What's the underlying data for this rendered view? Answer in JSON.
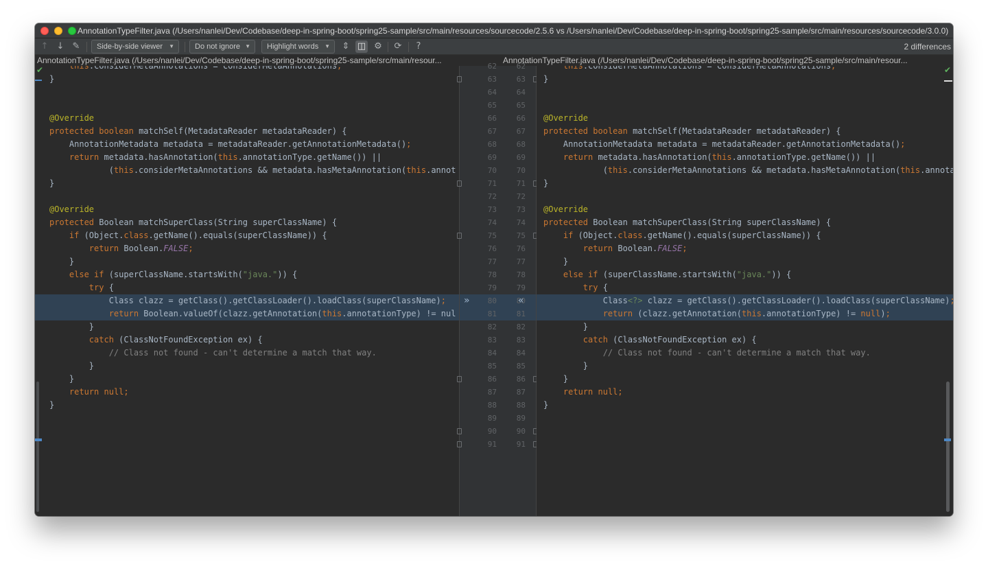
{
  "window": {
    "title": "AnnotationTypeFilter.java (/Users/nanlei/Dev/Codebase/deep-in-spring-boot/spring25-sample/src/main/resources/sourcecode/2.5.6 vs /Users/nanlei/Dev/Codebase/deep-in-spring-boot/spring25-sample/src/main/resources/sourcecode/3.0.0)"
  },
  "toolbar": {
    "prev_icon": "↑",
    "next_icon": "↓",
    "edit_icon": "✎",
    "viewer_label": "Side-by-side viewer",
    "ignore_label": "Do not ignore",
    "highlight_label": "Highlight words",
    "collapse_icon": "⇕",
    "sync_icon": "◫",
    "settings_icon": "⚙",
    "mark_icon": "⟳",
    "help_icon": "?",
    "differences": "2 differences"
  },
  "left_pane": {
    "header": "AnnotationTypeFilter.java (/Users/nanlei/Dev/Codebase/deep-in-spring-boot/spring25-sample/src/main/resour..."
  },
  "right_pane": {
    "header": "AnnotationTypeFilter.java (/Users/nanlei/Dev/Codebase/deep-in-spring-boot/spring25-sample/src/main/resour..."
  },
  "gutter": {
    "merge_left_icon": "»",
    "merge_right_icon": "«",
    "line_numbers": [
      "62",
      "63",
      "64",
      "65",
      "66",
      "67",
      "68",
      "69",
      "70",
      "71",
      "72",
      "73",
      "74",
      "75",
      "76",
      "77",
      "78",
      "79",
      "80",
      "81",
      "82",
      "83",
      "84",
      "85",
      "86",
      "87",
      "88",
      "89",
      "90",
      "91"
    ]
  },
  "code": {
    "left": [
      "\tthis.considerMetaAnnotations = considerMetaAnnotations;",
      "}",
      "",
      "",
      "@Override",
      "protected boolean matchSelf(MetadataReader metadataReader) {",
      "\tAnnotationMetadata metadata = metadataReader.getAnnotationMetadata();",
      "\treturn metadata.hasAnnotation(this.annotationType.getName()) ||",
      "\t\t\t(this.considerMetaAnnotations && metadata.hasMetaAnnotation(this.annot",
      "}",
      "",
      "@Override",
      "protected Boolean matchSuperClass(String superClassName) {",
      "\tif (Object.class.getName().equals(superClassName)) {",
      "\t\treturn Boolean.FALSE;",
      "\t}",
      "\telse if (superClassName.startsWith(\"java.\")) {",
      "\t\ttry {",
      "\t\t\tClass clazz = getClass().getClassLoader().loadClass(superClassName);",
      "\t\t\treturn Boolean.valueOf(clazz.getAnnotation(this.annotationType) != nul",
      "\t\t}",
      "\t\tcatch (ClassNotFoundException ex) {",
      "\t\t\t// Class not found - can't determine a match that way.",
      "\t\t}",
      "\t}",
      "\treturn null;",
      "}",
      "",
      "",
      ""
    ],
    "right": [
      "\tthis.considerMetaAnnotations = considerMetaAnnotations;",
      "}",
      "",
      "",
      "@Override",
      "protected boolean matchSelf(MetadataReader metadataReader) {",
      "\tAnnotationMetadata metadata = metadataReader.getAnnotationMetadata();",
      "\treturn metadata.hasAnnotation(this.annotationType.getName()) ||",
      "\t\t\t(this.considerMetaAnnotations && metadata.hasMetaAnnotation(this.annota",
      "}",
      "",
      "@Override",
      "protected Boolean matchSuperClass(String superClassName) {",
      "\tif (Object.class.getName().equals(superClassName)) {",
      "\t\treturn Boolean.FALSE;",
      "\t}",
      "\telse if (superClassName.startsWith(\"java.\")) {",
      "\t\ttry {",
      "\t\t\tClass<?> clazz = getClass().getClassLoader().loadClass(superClassName);",
      "\t\t\treturn (clazz.getAnnotation(this.annotationType) != null);",
      "\t\t}",
      "\t\tcatch (ClassNotFoundException ex) {",
      "\t\t\t// Class not found - can't determine a match that way.",
      "\t\t}",
      "\t}",
      "\treturn null;",
      "}",
      "",
      "",
      ""
    ],
    "changed_rows": [
      18,
      19
    ]
  },
  "colors": {
    "background": "#2b2b2b",
    "keyword": "#cc7832",
    "annotation": "#bbb529",
    "string": "#6a8759",
    "comment": "#808080",
    "changed_bg": "#304254"
  }
}
